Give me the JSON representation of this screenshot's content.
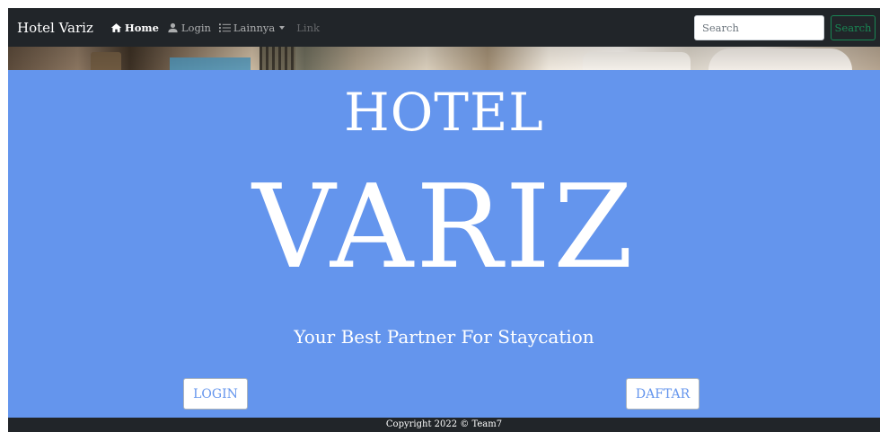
{
  "navbar": {
    "brand": "Hotel Variz",
    "items": [
      {
        "label": "Home",
        "icon": "home-icon",
        "active": true
      },
      {
        "label": "Login",
        "icon": "user-icon",
        "active": false
      },
      {
        "label": "Lainnya",
        "icon": "list-icon",
        "dropdown": true
      },
      {
        "label": "Link",
        "disabled": true
      }
    ],
    "search": {
      "placeholder": "Search",
      "value": "",
      "button_label": "Search"
    }
  },
  "hero": {
    "title": "HOTEL",
    "name": "VARIZ",
    "tagline": "Your Best Partner For Staycation",
    "login_button": "LOGIN",
    "register_button": "DAFTAR",
    "background_color": "#6495ed"
  },
  "footer": {
    "text": "Copyright 2022 © Team7"
  },
  "colors": {
    "navbar_bg": "#212529",
    "search_button": "#198754",
    "accent": "#6495ed"
  }
}
